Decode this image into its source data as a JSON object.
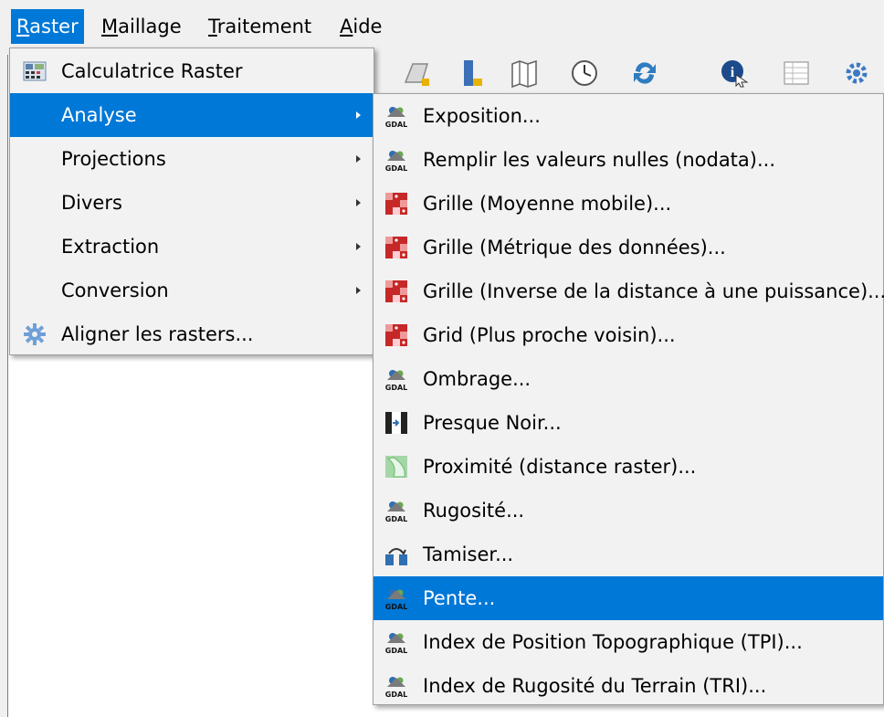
{
  "menubar": {
    "items": [
      {
        "first": "R",
        "rest": "aster"
      },
      {
        "first": "M",
        "rest": "aillage"
      },
      {
        "first": "T",
        "rest": "raitement"
      },
      {
        "first": "A",
        "rest": "ide"
      }
    ]
  },
  "raster_menu": {
    "items": [
      {
        "label": "Calculatrice Raster",
        "icon": "raster-calculator-icon"
      },
      {
        "label": "Analyse",
        "icon": "",
        "submenu": true,
        "highlighted": true
      },
      {
        "label": "Projections",
        "icon": "",
        "submenu": true
      },
      {
        "label": "Divers",
        "icon": "",
        "submenu": true
      },
      {
        "label": "Extraction",
        "icon": "",
        "submenu": true
      },
      {
        "label": "Conversion",
        "icon": "",
        "submenu": true
      },
      {
        "label": "Aligner les rasters...",
        "icon": "gear-icon"
      }
    ]
  },
  "analyse_submenu": {
    "items": [
      {
        "label": "Exposition...",
        "icon": "gdal-icon"
      },
      {
        "label": "Remplir les valeurs nulles (nodata)...",
        "icon": "gdal-icon"
      },
      {
        "label": "Grille (Moyenne mobile)...",
        "icon": "grid-icon"
      },
      {
        "label": "Grille (Métrique des données)...",
        "icon": "grid-icon"
      },
      {
        "label": "Grille (Inverse de la distance à une puissance)...",
        "icon": "grid-icon"
      },
      {
        "label": "Grid (Plus proche voisin)...",
        "icon": "grid-icon"
      },
      {
        "label": "Ombrage...",
        "icon": "gdal-icon"
      },
      {
        "label": "Presque Noir...",
        "icon": "nearblack-icon"
      },
      {
        "label": "Proximité (distance raster)...",
        "icon": "proximity-icon"
      },
      {
        "label": "Rugosité...",
        "icon": "gdal-icon"
      },
      {
        "label": "Tamiser...",
        "icon": "sieve-icon"
      },
      {
        "label": "Pente...",
        "icon": "gdal-icon",
        "highlighted": true
      },
      {
        "label": "Index de Position Topographique (TPI)...",
        "icon": "gdal-icon"
      },
      {
        "label": "Index de Rugosité du Terrain (TRI)...",
        "icon": "gdal-icon"
      }
    ]
  },
  "colors": {
    "highlight": "#0078d7",
    "menu_bg": "#f2f2f2"
  }
}
